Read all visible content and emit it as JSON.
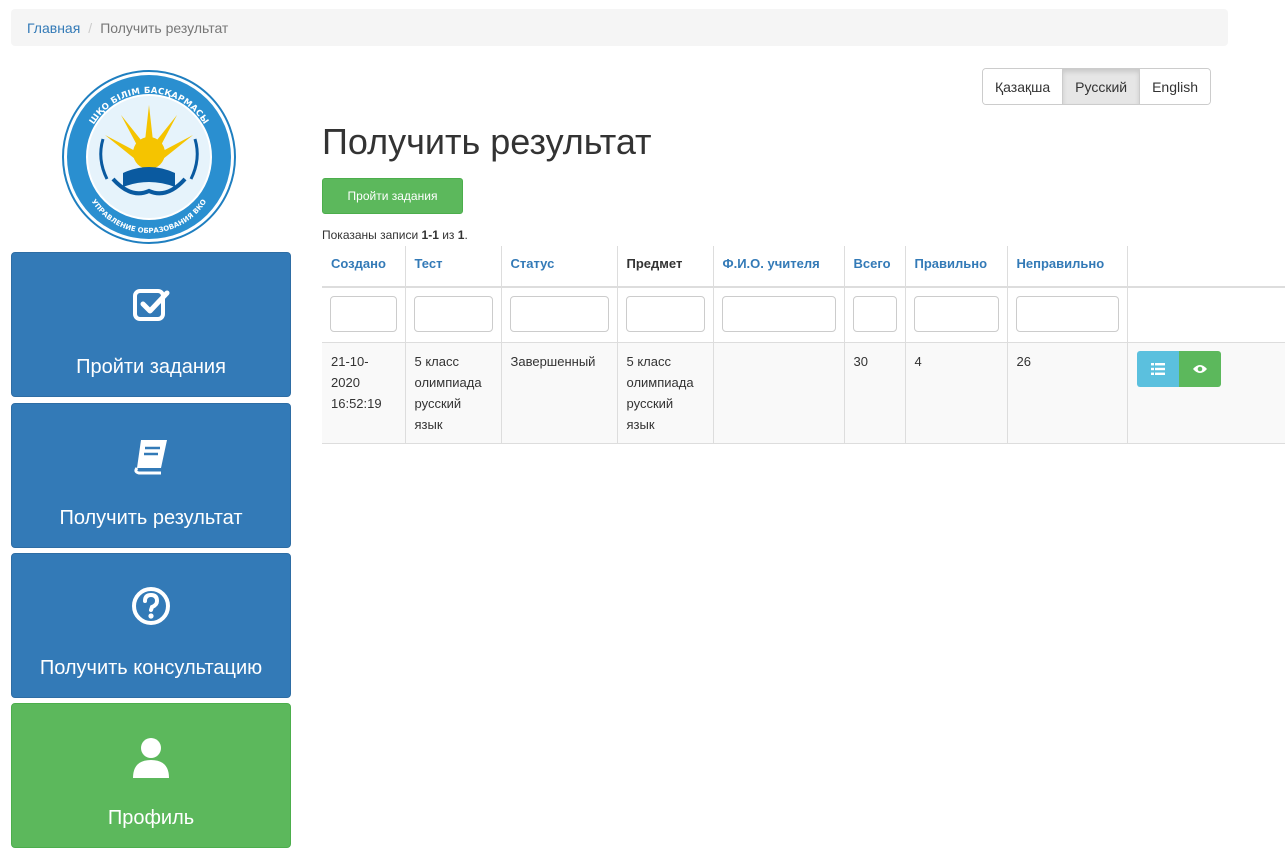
{
  "breadcrumb": {
    "home": "Главная",
    "separator": "/",
    "current": "Получить результат"
  },
  "logo": {
    "top_text": "ШҚО БІЛІМ БАСҚАРМАСЫ",
    "bottom_text": "УПРАВЛЕНИЕ ОБРАЗОВАНИЯ ВКО",
    "colors": {
      "ring": "#1f7fc0",
      "sun": "#f5c400",
      "ornament": "#0a5aa0"
    }
  },
  "sidebar": [
    {
      "label": "Пройти задания",
      "icon": "check-square-icon",
      "color": "#337ab7"
    },
    {
      "label": "Получить результат",
      "icon": "book-icon",
      "color": "#337ab7"
    },
    {
      "label": "Получить консультацию",
      "icon": "question-circle-icon",
      "color": "#337ab7"
    },
    {
      "label": "Профиль",
      "icon": "user-icon",
      "color": "#5cb85c"
    }
  ],
  "languages": {
    "kk": "Қазақша",
    "ru": "Русский",
    "en": "English",
    "active": "Русский"
  },
  "page": {
    "title": "Получить результат",
    "go_button": "Пройти задания",
    "summary_prefix": "Показаны записи ",
    "summary_range": "1-1",
    "summary_mid": " из ",
    "summary_total": "1",
    "summary_end": "."
  },
  "table": {
    "headers": [
      "Создано",
      "Тест",
      "Статус",
      "Предмет",
      "Ф.И.О. учителя",
      "Всего",
      "Правильно",
      "Неправильно"
    ],
    "rows": [
      {
        "created": "21-10-2020 16:52:19",
        "test": "5 класс олимпиада русский язык",
        "status": "Завершенный",
        "subject": "5 класс олимпиада русский язык",
        "teacher": "",
        "total": "30",
        "correct": "4",
        "incorrect": "26",
        "actions": [
          "list-icon",
          "eye-icon"
        ]
      }
    ]
  },
  "colors": {
    "primary": "#337ab7",
    "success": "#5cb85c",
    "info": "#5bc0de"
  }
}
